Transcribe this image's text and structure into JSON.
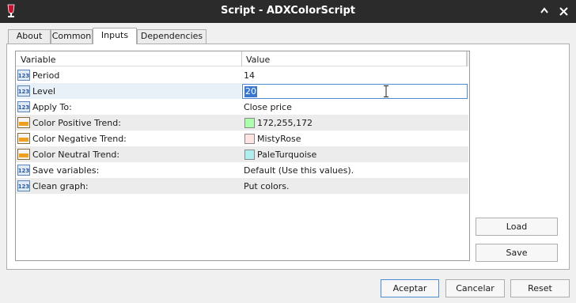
{
  "window": {
    "title": "Script - ADXColorScript",
    "help_icon": "help-icon",
    "close_icon": "close-icon"
  },
  "tabs": [
    {
      "label": "About"
    },
    {
      "label": "Common"
    },
    {
      "label": "Inputs",
      "active": true
    },
    {
      "label": "Dependencies"
    }
  ],
  "grid": {
    "col_variable": "Variable",
    "col_value": "Value",
    "rows": [
      {
        "name": "Period",
        "value": "14",
        "icon": "numeric-icon"
      },
      {
        "name": "Level",
        "value": "20",
        "icon": "numeric-icon",
        "editing": true
      },
      {
        "name": "Apply To:",
        "value": "Close price",
        "icon": "numeric-icon"
      },
      {
        "name": "Color Positive Trend:",
        "value": "172,255,172",
        "icon": "color-icon",
        "swatch": "#acffac"
      },
      {
        "name": "Color Negative Trend:",
        "value": "MistyRose",
        "icon": "color-icon",
        "swatch": "#ffe4e1"
      },
      {
        "name": "Color Neutral Trend:",
        "value": "PaleTurquoise",
        "icon": "color-icon",
        "swatch": "#afeeee"
      },
      {
        "name": "Save variables:",
        "value": "Default (Use this values).",
        "icon": "numeric-icon"
      },
      {
        "name": "Clean graph:",
        "value": "Put colors.",
        "icon": "numeric-icon"
      }
    ]
  },
  "side_buttons": {
    "load": "Load",
    "save": "Save"
  },
  "footer_buttons": {
    "accept": "Aceptar",
    "cancel": "Cancelar",
    "reset": "Reset"
  }
}
